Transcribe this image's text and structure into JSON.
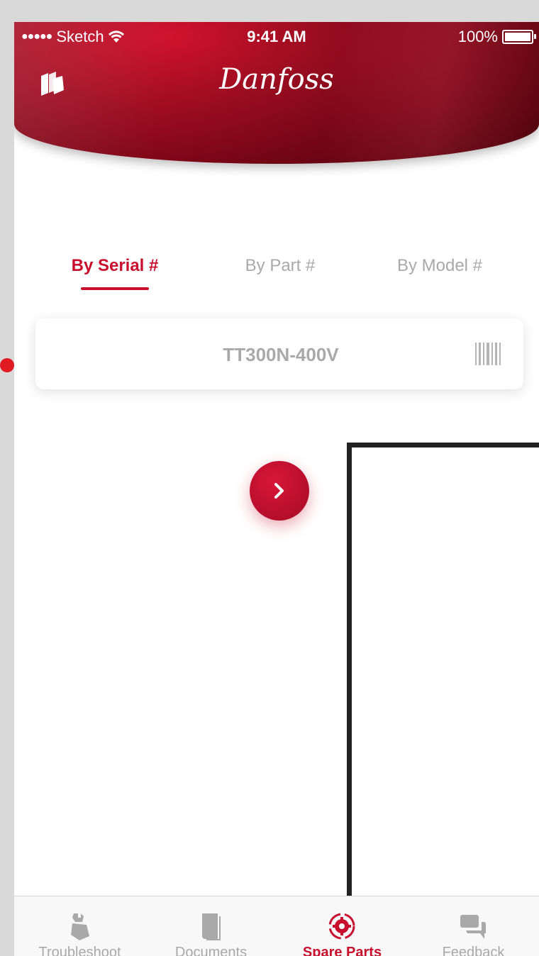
{
  "status_bar": {
    "carrier": "Sketch",
    "time": "9:41 AM",
    "battery": "100%"
  },
  "header": {
    "logo_text": "Danfoss"
  },
  "search_tabs": [
    {
      "label": "By Serial #",
      "active": true
    },
    {
      "label": "By Part #",
      "active": false
    },
    {
      "label": "By Model #",
      "active": false
    }
  ],
  "search": {
    "value": "TT300N-400V"
  },
  "tab_bar": [
    {
      "label": "Troubleshoot",
      "icon": "wrench-hand-icon",
      "active": false
    },
    {
      "label": "Documents",
      "icon": "book-icon",
      "active": false
    },
    {
      "label": "Spare Parts",
      "icon": "gear-icon",
      "active": true
    },
    {
      "label": "Feedback",
      "icon": "chat-bubbles-icon",
      "active": false
    }
  ],
  "colors": {
    "accent": "#c8102e",
    "inactive": "#a9a9a9",
    "background": "#ffffff"
  }
}
